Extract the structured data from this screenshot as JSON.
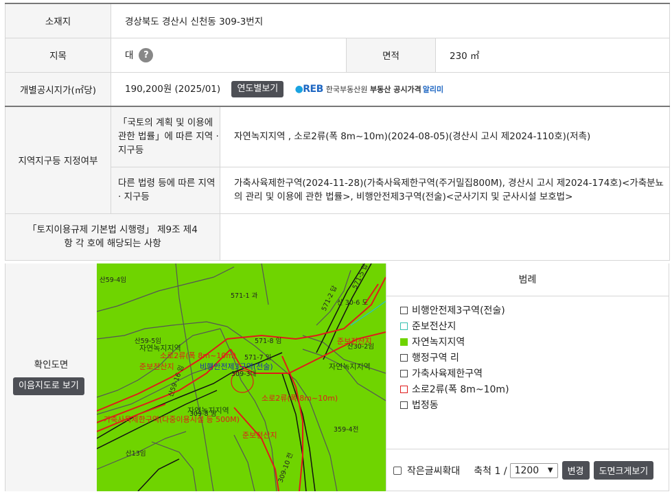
{
  "rows": {
    "location": {
      "label": "소재지",
      "value": "경상북도 경산시 신천동 309-3번지"
    },
    "land_category": {
      "label": "지목",
      "value": "대",
      "help_icon": "question-icon"
    },
    "area": {
      "label": "면적",
      "value": "230 ㎡"
    },
    "official_price": {
      "label": "개별공시지가(㎡당)",
      "value": "190,200원 (2025/01)",
      "button": "연도별보기",
      "reb_logo": "REB",
      "reb_name": "한국부동산원",
      "reb_service": "부동산 공시가격",
      "reb_alimi": "알리미"
    },
    "zoning": {
      "label": "지역지구등 지정여부",
      "national_label": "「국토의 계획 및 이용에 관한 법률」에 따른 지역 · 지구등",
      "national_value": "자연녹지지역 , 소로2류(폭 8m~10m)(2024-08-05)(경산시 고시 제2024-110호)(저촉)",
      "other_label": "다른 법령 등에 따른 지역 · 지구등",
      "other_value": "가축사육제한구역(2024-11-28)(가축사육제한구역(주거밀집800M), 경산시 고시 제2024-174호)<가축분뇨의 관리 및 이용에 관한 법률>, 비행안전제3구역(전술)<군사기지 및 군사시설 보호법>"
    },
    "regulation": {
      "label": "「토지이용규제 기본법 시행령」 제9조 제4항 각 호에 해당되는 사항",
      "value": ""
    }
  },
  "map_section": {
    "label": "확인도면",
    "button": "이음지도로 보기",
    "labels": [
      "산59-4임",
      "571-1 과",
      "571-2 답",
      "571-5 답",
      "산 30-6 도",
      "산59-5임",
      "자연녹지지역",
      "571-8 임",
      "준보전산지",
      "산30-2임",
      "소로2류(폭 8m~10m)",
      "571-7 임",
      "준보전산지",
      "비행안전제3구역(전술)",
      "309-3대",
      "산59-16 임",
      "자연녹지지역",
      "소로2류(폭 8m~10m)",
      "309-8 임",
      "자연녹지지역",
      "가축사육제한구역(다중이용시설 등 500M)",
      "준보전산지",
      "359-4전",
      "산13임",
      "309-10 전"
    ]
  },
  "legend": {
    "title": "범례",
    "items": [
      {
        "label": "비행안전제3구역(전술)",
        "color": "#ffffff",
        "border": "#444444"
      },
      {
        "label": "준보전산지",
        "color": "#ffffff",
        "border": "#35c0b0"
      },
      {
        "label": "자연녹지지역",
        "color": "#6fd400",
        "border": "#6fd400"
      },
      {
        "label": "행정구역 리",
        "color": "#ffffff",
        "border": "#444444"
      },
      {
        "label": "가축사육제한구역",
        "color": "#ffffff",
        "border": "#444444"
      },
      {
        "label": "소로2류(폭 8m~10m)",
        "color": "#ffffff",
        "border": "#e01b1b"
      },
      {
        "label": "법정동",
        "color": "#ffffff",
        "border": "#444444"
      }
    ],
    "small_text_label": "작은글씨확대",
    "scale_label": "축척 1 /",
    "scale_value": "1200",
    "change_button": "변경",
    "zoom_button": "도면크게보기"
  },
  "colors": {
    "zone_green": "#6fd400",
    "road_red": "#e01b1b",
    "dark_button": "#4d4f55"
  }
}
